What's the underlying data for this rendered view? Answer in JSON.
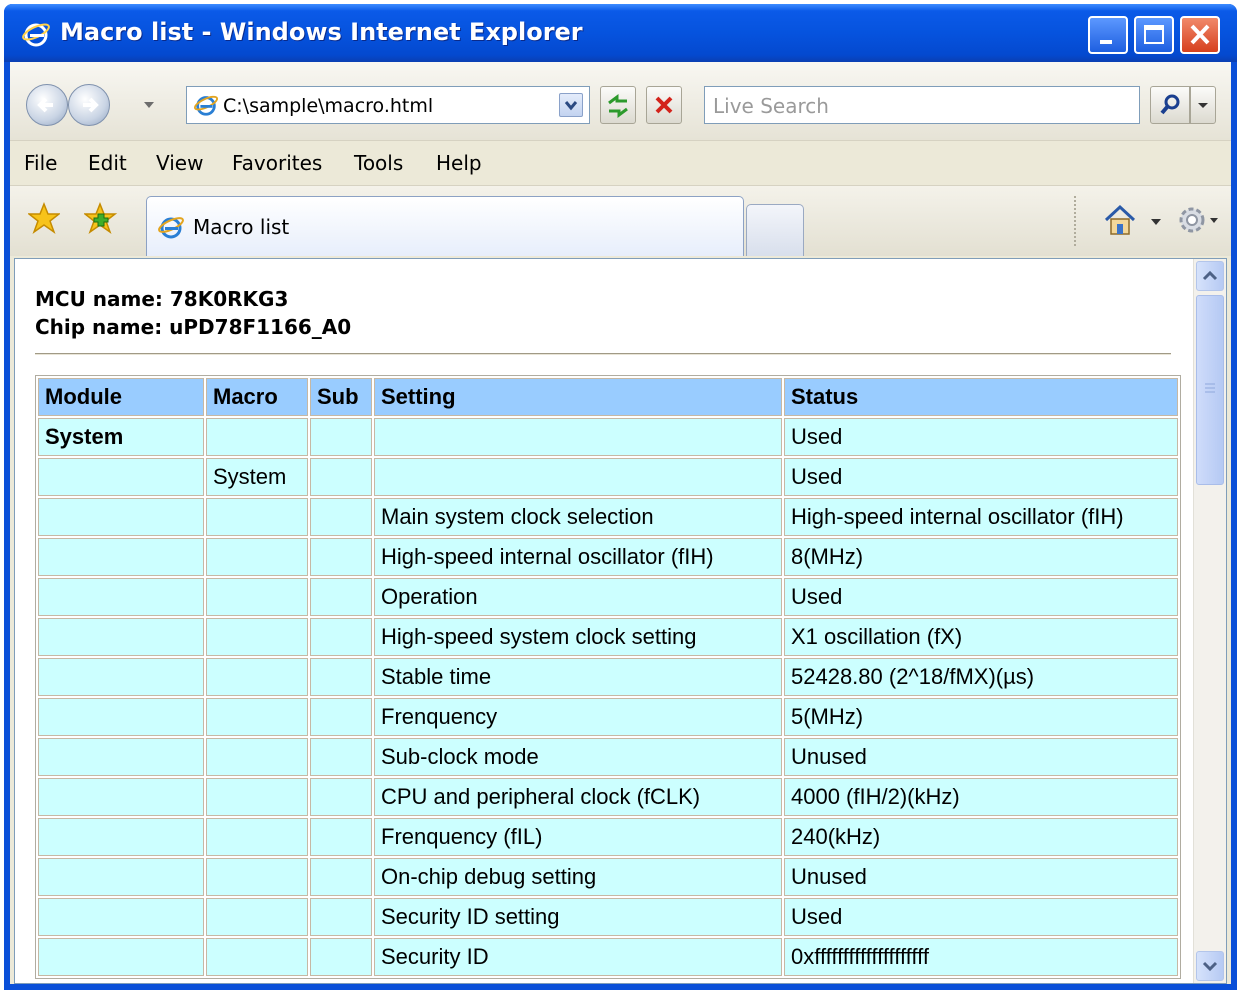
{
  "window": {
    "title": "Macro list - Windows Internet Explorer"
  },
  "address_bar": {
    "url": "C:\\sample\\macro.html"
  },
  "search": {
    "placeholder": "Live Search"
  },
  "menu": {
    "items": [
      "File",
      "Edit",
      "View",
      "Favorites",
      "Tools",
      "Help"
    ]
  },
  "tabs": {
    "active_label": "Macro list"
  },
  "page": {
    "mcu_line": "MCU name: 78K0RKG3",
    "chip_line": "Chip name: uPD78F1166_A0",
    "table": {
      "headers": [
        "Module",
        "Macro",
        "Sub",
        "Setting",
        "Status"
      ],
      "rows": [
        [
          "System",
          "",
          "",
          "",
          "Used"
        ],
        [
          "",
          "System",
          "",
          "",
          "Used"
        ],
        [
          "",
          "",
          "",
          "Main system clock selection",
          "High-speed internal oscillator (fIH)"
        ],
        [
          "",
          "",
          "",
          "High-speed internal oscillator (fIH)",
          "8(MHz)"
        ],
        [
          "",
          "",
          "",
          "Operation",
          "Used"
        ],
        [
          "",
          "",
          "",
          "High-speed system clock setting",
          "X1 oscillation (fX)"
        ],
        [
          "",
          "",
          "",
          "Stable time",
          "52428.80 (2^18/fMX)(µs)"
        ],
        [
          "",
          "",
          "",
          "Frenquency",
          "5(MHz)"
        ],
        [
          "",
          "",
          "",
          "Sub-clock mode",
          "Unused"
        ],
        [
          "",
          "",
          "",
          "CPU and peripheral clock (fCLK)",
          "4000 (fIH/2)(kHz)"
        ],
        [
          "",
          "",
          "",
          "Frenquency (fIL)",
          "240(kHz)"
        ],
        [
          "",
          "",
          "",
          "On-chip debug setting",
          "Unused"
        ],
        [
          "",
          "",
          "",
          "Security ID setting",
          "Used"
        ],
        [
          "",
          "",
          "",
          "Security ID",
          "0xffffffffffffffffffff"
        ]
      ]
    }
  },
  "colors": {
    "header_bg": "#99ccff",
    "cell_bg": "#ccffff",
    "titlebar": "#0653de"
  },
  "icons": [
    "ie-icon",
    "back-icon",
    "forward-icon",
    "refresh-icon",
    "stop-icon",
    "search-icon",
    "favorites-star-icon",
    "add-favorites-icon",
    "home-icon",
    "tools-gear-icon"
  ]
}
